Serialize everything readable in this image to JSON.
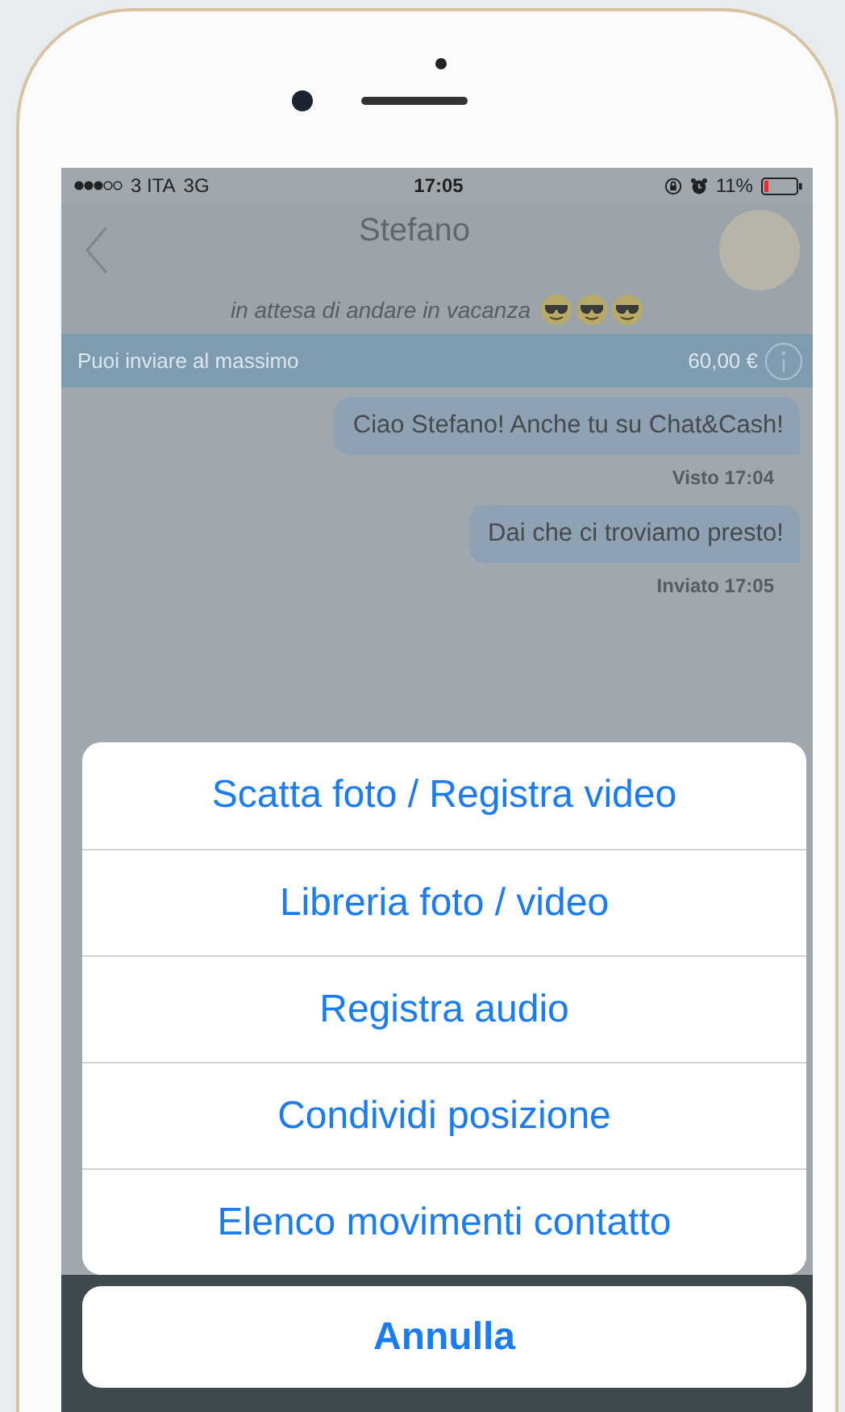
{
  "status_bar": {
    "carrier": "3 ITA",
    "network": "3G",
    "time": "17:05",
    "battery": "11%"
  },
  "header": {
    "title": "Stefano",
    "status": "in attesa di andare in vacanza"
  },
  "limit_banner": {
    "label": "Puoi inviare al massimo",
    "amount": "60,00 €"
  },
  "messages": [
    {
      "text": "Ciao Stefano! Anche tu su Chat&Cash!",
      "meta": "Visto 17:04"
    },
    {
      "text": "Dai che ci troviamo presto!",
      "meta": "Inviato 17:05"
    }
  ],
  "action_sheet": {
    "actions": [
      "Scatta foto / Registra video",
      "Libreria foto / video",
      "Registra audio",
      "Condividi posizione",
      "Elenco movimenti contatto"
    ],
    "cancel": "Annulla"
  }
}
